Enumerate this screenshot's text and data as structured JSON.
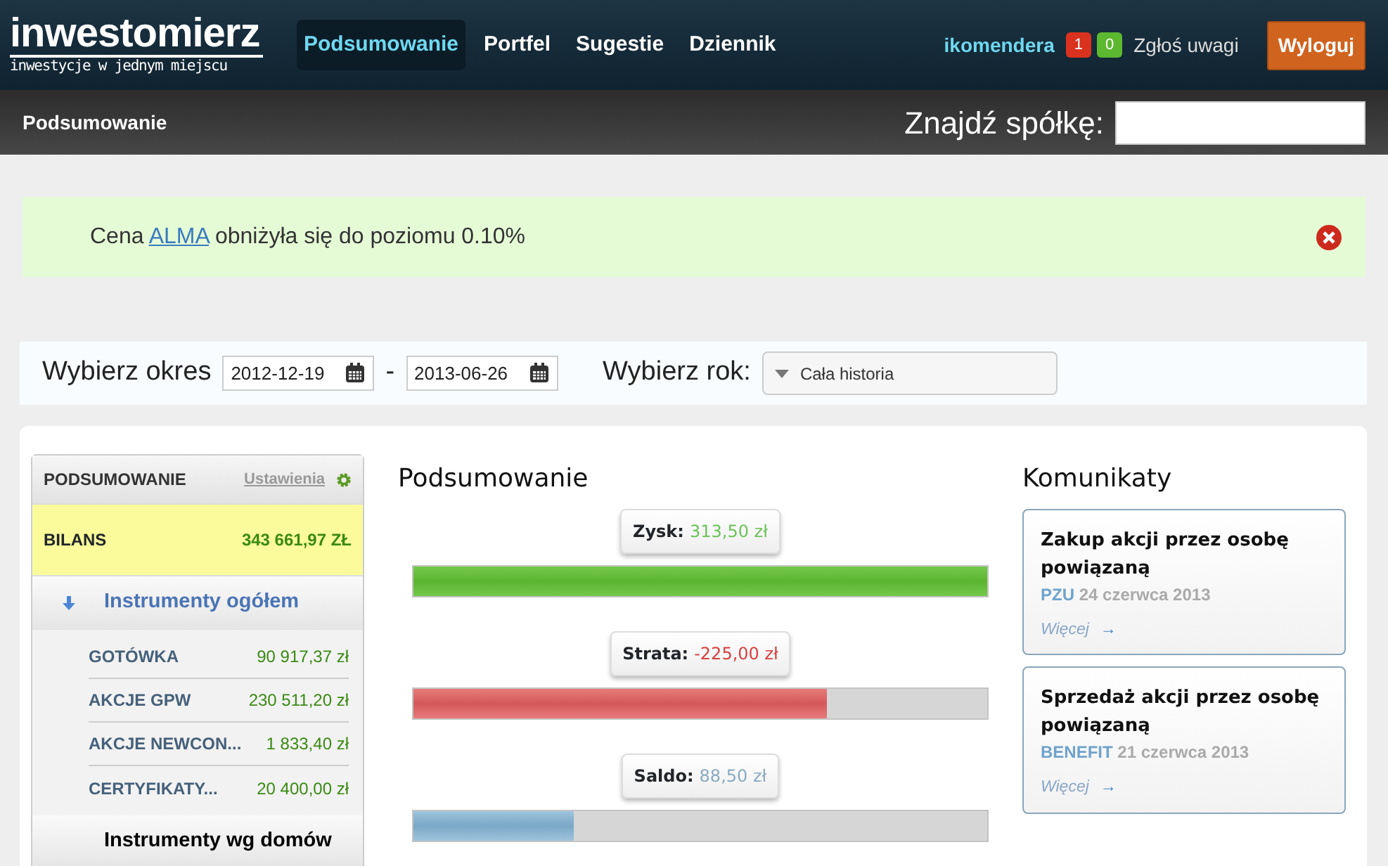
{
  "logo": {
    "name": "inwestomierz",
    "tagline": "inwestycje w jednym miejscu"
  },
  "nav": [
    {
      "label": "Podsumowanie",
      "selected": true
    },
    {
      "label": "Portfel",
      "selected": false
    },
    {
      "label": "Sugestie",
      "selected": false
    },
    {
      "label": "Dziennik",
      "selected": false
    }
  ],
  "user": {
    "name": "ikomendera",
    "badges": [
      {
        "count": "1",
        "color": "#d9321f"
      },
      {
        "count": "0",
        "color": "#5cb82e"
      }
    ],
    "feedback": "Zgłoś uwagi",
    "logout": "Wyloguj"
  },
  "subbar": {
    "title": "Podsumowanie",
    "search_label": "Znajdź spółkę:"
  },
  "alert": {
    "before": "Cena",
    "link": "ALMA",
    "after": "obniżyła się do poziomu 0.10%"
  },
  "filter": {
    "period_label": "Wybierz okres",
    "date_from": "2012-12-19",
    "separator": "-",
    "date_to": "2013-06-26",
    "year_label": "Wybierz rok:",
    "year_value": "Cała historia"
  },
  "summary_panel": {
    "title": "PODSUMOWANIE",
    "settings": "Ustawienia",
    "balance_label": "BILANS",
    "balance_value": "343 661,97 ZŁ",
    "groups": [
      {
        "label": "Instrumenty ogółem",
        "expanded": true,
        "items": [
          {
            "label": "GOTÓWKA",
            "value": "90 917,37 zł"
          },
          {
            "label": "AKCJE GPW",
            "value": "230 511,20 zł"
          },
          {
            "label": "AKCJE NEWCON...",
            "value": "1 833,40 zł"
          },
          {
            "label": "CERTYFIKATY...",
            "value": "20 400,00 zł"
          }
        ]
      },
      {
        "label": "Instrumenty wg domów",
        "expanded": false
      }
    ]
  },
  "summary": {
    "title": "Podsumowanie",
    "bars": [
      {
        "label": "Zysk:",
        "value": "313,50 zł",
        "kind": "profit",
        "level": 1.0
      },
      {
        "label": "Strata:",
        "value": "-225,00 zł",
        "kind": "loss",
        "level": 0.72
      },
      {
        "label": "Saldo:",
        "value": "88,50 zł",
        "kind": "balance",
        "level": 0.28
      }
    ]
  },
  "messages": {
    "title": "Komunikaty",
    "items": [
      {
        "title": "Zakup akcji przez osobę powiązaną",
        "company": "PZU",
        "date": "24 czerwca 2013",
        "more": "Więcej",
        "arrow": "→"
      },
      {
        "title": "Sprzedaż akcji przez osobę powiązaną",
        "company": "BENEFIT",
        "date": "21 czerwca 2013",
        "more": "Więcej",
        "arrow": "→"
      }
    ]
  }
}
